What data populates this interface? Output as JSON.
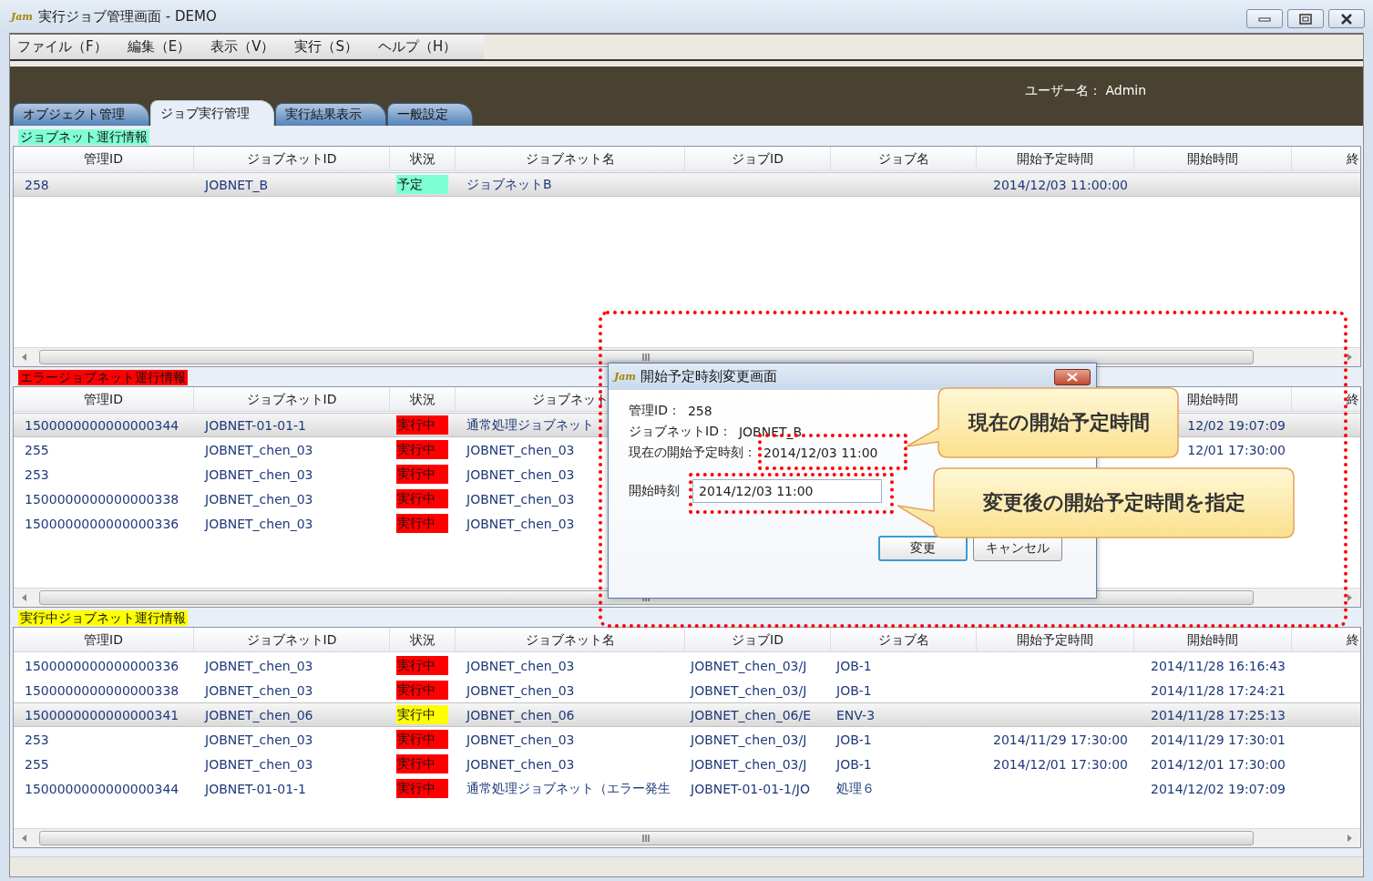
{
  "window": {
    "logo": "Jam",
    "title": "実行ジョブ管理画面 - DEMO"
  },
  "menu": [
    "ファイル（F）",
    "編集（E）",
    "表示（V）",
    "実行（S）",
    "ヘルプ（H）"
  ],
  "user_label": "ユーザー名： Admin",
  "tabs": [
    {
      "label": "オブジェクト管理",
      "selected": false
    },
    {
      "label": "ジョブ実行管理",
      "selected": true
    },
    {
      "label": "実行結果表示",
      "selected": false
    },
    {
      "label": "一般設定",
      "selected": false
    }
  ],
  "sections": [
    {
      "title": "ジョブネット運行情報",
      "color": "#7fffd4",
      "columns": {
        "management_id": "管理ID",
        "jobnet_id": "ジョブネットID",
        "status": "状況",
        "jobnet_name": "ジョブネット名",
        "job_id": "ジョブID",
        "job_name": "ジョブ名",
        "scheduled_start": "開始予定時間",
        "start_time": "開始時間",
        "column_9": "終"
      },
      "rows": [
        {
          "management_id": "258",
          "jobnet_id": "JOBNET_B",
          "status": "予定",
          "color": "#7fffd4",
          "jobnet_name": "ジョブネットB",
          "scheduled_start": "2014/12/03 11:00:00",
          "selected": true
        }
      ]
    },
    {
      "title": "エラージョブネット運行情報",
      "color": "#ff0000",
      "columns": {
        "management_id": "管理ID",
        "jobnet_id": "ジョブネットID",
        "status": "状況",
        "jobnet_name": "ジョブネット",
        "start_time": "開始時間",
        "column_9": "終"
      },
      "rows": [
        {
          "management_id": "1500000000000000344",
          "jobnet_id": "JOBNET-01-01-1",
          "status": "実行中",
          "color": "#ff0000",
          "jobnet_name": "通常処理ジョブネット",
          "start_time": "12/02 19:07:09",
          "selected": true
        },
        {
          "management_id": "255",
          "jobnet_id": "JOBNET_chen_03",
          "status": "実行中",
          "color": "#ff0000",
          "jobnet_name": "JOBNET_chen_03",
          "start_time": "12/01 17:30:00",
          "selected": false
        },
        {
          "management_id": "253",
          "jobnet_id": "JOBNET_chen_03",
          "status": "実行中",
          "color": "#ff0000",
          "jobnet_name": "JOBNET_chen_03",
          "selected": false
        },
        {
          "management_id": "1500000000000000338",
          "jobnet_id": "JOBNET_chen_03",
          "status": "実行中",
          "color": "#ff0000",
          "jobnet_name": "JOBNET_chen_03",
          "selected": false
        },
        {
          "management_id": "1500000000000000336",
          "jobnet_id": "JOBNET_chen_03",
          "status": "実行中",
          "color": "#ff0000",
          "jobnet_name": "JOBNET_chen_03",
          "selected": false
        }
      ]
    },
    {
      "title": "実行中ジョブネット運行情報",
      "color": "#ffff00",
      "columns": {
        "management_id": "管理ID",
        "jobnet_id": "ジョブネットID",
        "status": "状況",
        "jobnet_name": "ジョブネット名",
        "job_id": "ジョブID",
        "job_name": "ジョブ名",
        "scheduled_start": "開始予定時間",
        "start_time": "開始時間",
        "column_9": "終"
      },
      "rows": [
        {
          "management_id": "1500000000000000336",
          "jobnet_id": "JOBNET_chen_03",
          "status": "実行中",
          "color": "#ff0000",
          "jobnet_name": "JOBNET_chen_03",
          "job_id": "JOBNET_chen_03/J",
          "job_name": "JOB-1",
          "start_time": "2014/11/28 16:16:43",
          "selected": false
        },
        {
          "management_id": "1500000000000000338",
          "jobnet_id": "JOBNET_chen_03",
          "status": "実行中",
          "color": "#ff0000",
          "jobnet_name": "JOBNET_chen_03",
          "job_id": "JOBNET_chen_03/J",
          "job_name": "JOB-1",
          "start_time": "2014/11/28 17:24:21",
          "selected": false
        },
        {
          "management_id": "1500000000000000341",
          "jobnet_id": "JOBNET_chen_06",
          "status": "実行中",
          "color": "#ffff00",
          "jobnet_name": "JOBNET_chen_06",
          "job_id": "JOBNET_chen_06/E",
          "job_name": "ENV-3",
          "start_time": "2014/11/28 17:25:13",
          "selected": true
        },
        {
          "management_id": "253",
          "jobnet_id": "JOBNET_chen_03",
          "status": "実行中",
          "color": "#ff0000",
          "jobnet_name": "JOBNET_chen_03",
          "job_id": "JOBNET_chen_03/J",
          "job_name": "JOB-1",
          "scheduled_start": "2014/11/29 17:30:00",
          "start_time": "2014/11/29 17:30:01",
          "selected": false
        },
        {
          "management_id": "255",
          "jobnet_id": "JOBNET_chen_03",
          "status": "実行中",
          "color": "#ff0000",
          "jobnet_name": "JOBNET_chen_03",
          "job_id": "JOBNET_chen_03/J",
          "job_name": "JOB-1",
          "scheduled_start": "2014/12/01 17:30:00",
          "start_time": "2014/12/01 17:30:00",
          "selected": false
        },
        {
          "management_id": "1500000000000000344",
          "jobnet_id": "JOBNET-01-01-1",
          "status": "実行中",
          "color": "#ff0000",
          "jobnet_name": "通常処理ジョブネット（エラー発生",
          "job_id": "JOBNET-01-01-1/JO",
          "job_name": "処理６",
          "start_time": "2014/12/02 19:07:09",
          "selected": false
        }
      ]
    }
  ],
  "dialog": {
    "logo": "Jam",
    "title": "開始予定時刻変更画面",
    "info": [
      {
        "label": "管理ID：",
        "value": "258"
      },
      {
        "label": "ジョブネットID：",
        "value": "JOBNET_B"
      },
      {
        "label": "現在の開始予定時刻：",
        "value": "2014/12/03 11:00"
      }
    ],
    "input": {
      "label": "開始時刻",
      "value": "2014/12/03 11:00"
    },
    "buttons": [
      {
        "label": "変更",
        "focused": true
      },
      {
        "label": "キャンセル",
        "focused": false
      }
    ]
  },
  "callouts": [
    "現在の開始予定時間",
    "変更後の開始予定時間を指定"
  ]
}
